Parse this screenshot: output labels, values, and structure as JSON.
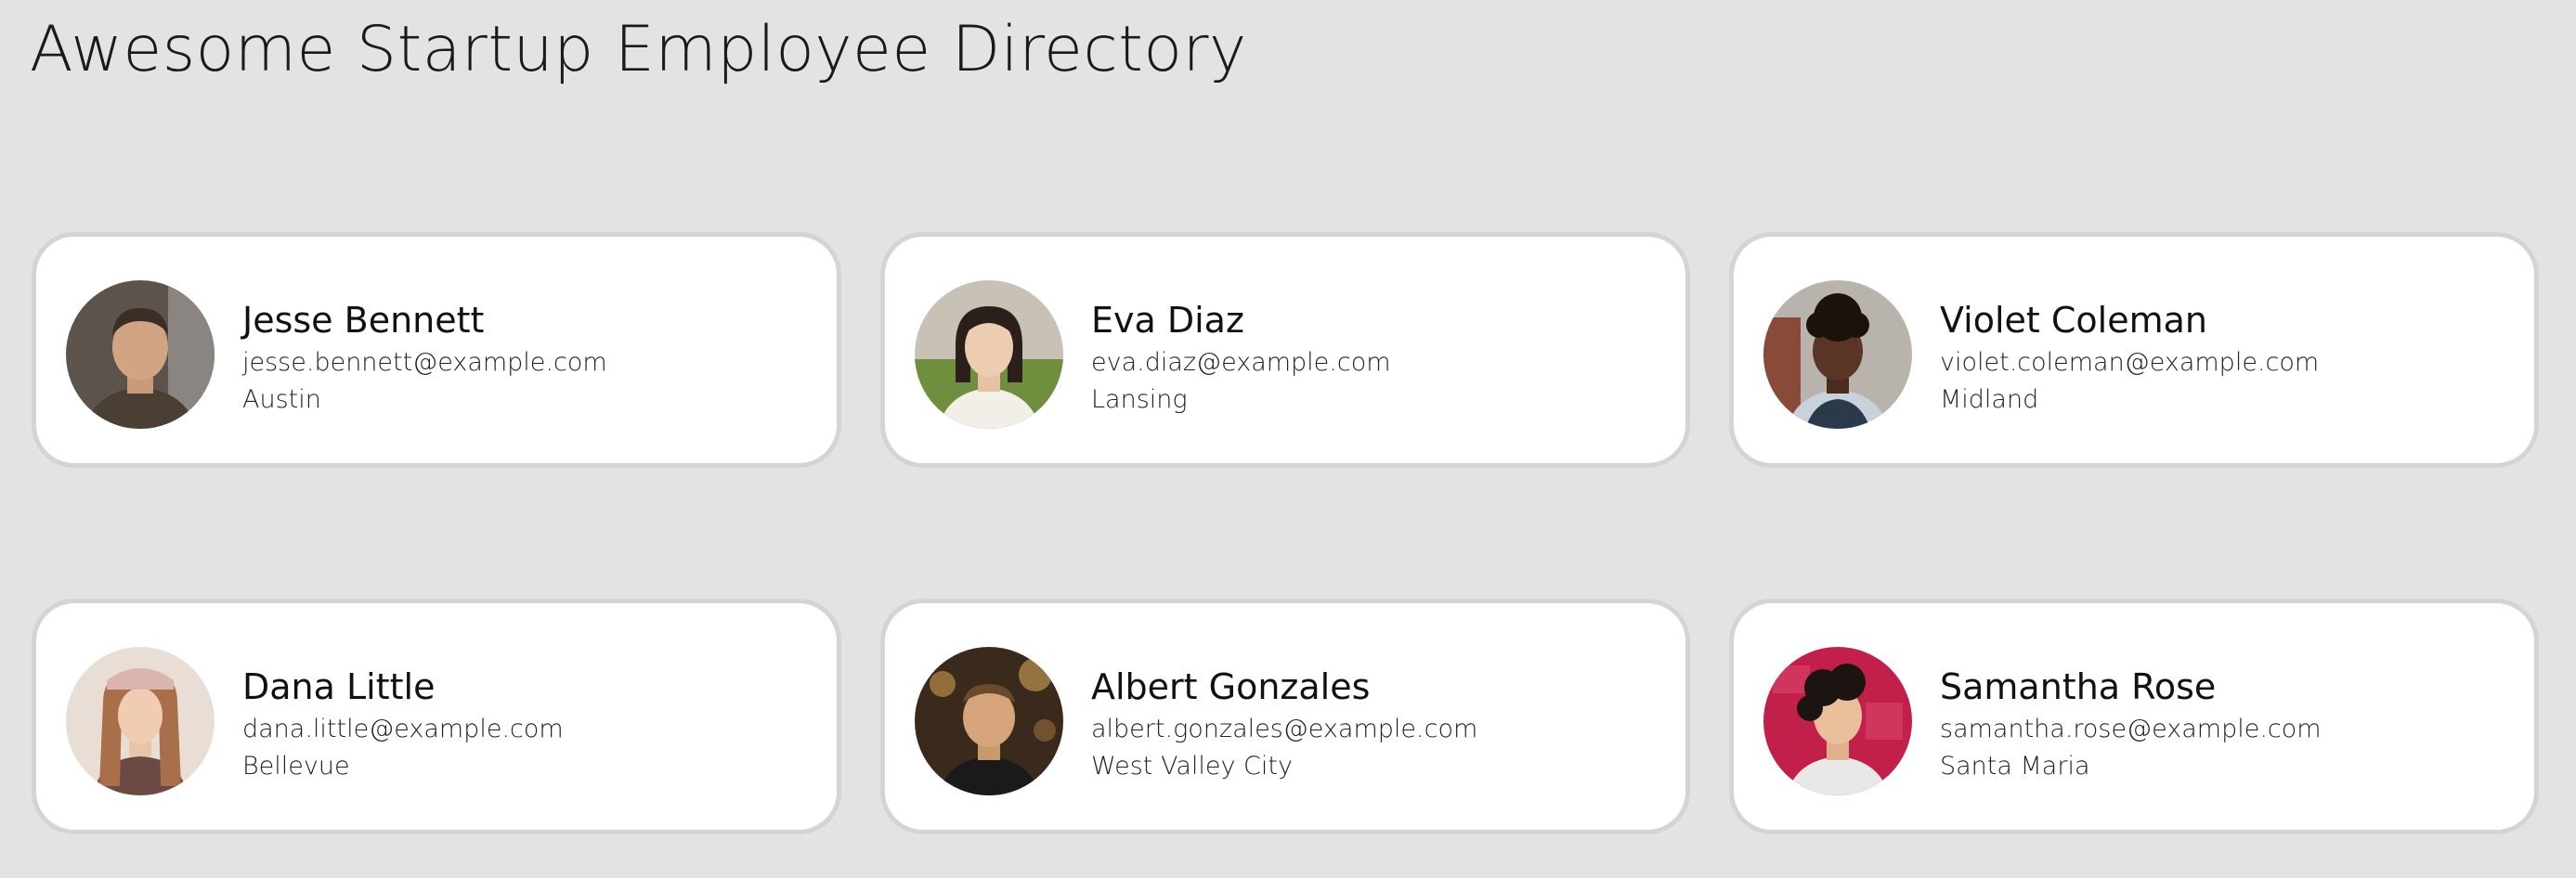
{
  "page": {
    "title": "Awesome Startup Employee Directory"
  },
  "colors": {
    "background": "#e3e3e3",
    "card": "#ffffff",
    "card_border": "#d4d4d4"
  },
  "employees": [
    {
      "name": "Jesse Bennett",
      "email": "jesse.bennett@example.com",
      "city": "Austin",
      "avatar_icon": "person-photo"
    },
    {
      "name": "Eva Diaz",
      "email": "eva.diaz@example.com",
      "city": "Lansing",
      "avatar_icon": "person-photo"
    },
    {
      "name": "Violet Coleman",
      "email": "violet.coleman@example.com",
      "city": "Midland",
      "avatar_icon": "person-photo"
    },
    {
      "name": "Dana Little",
      "email": "dana.little@example.com",
      "city": "Bellevue",
      "avatar_icon": "person-photo"
    },
    {
      "name": "Albert Gonzales",
      "email": "albert.gonzales@example.com",
      "city": "West Valley City",
      "avatar_icon": "person-photo"
    },
    {
      "name": "Samantha Rose",
      "email": "samantha.rose@example.com",
      "city": "Santa Maria",
      "avatar_icon": "person-photo"
    }
  ]
}
